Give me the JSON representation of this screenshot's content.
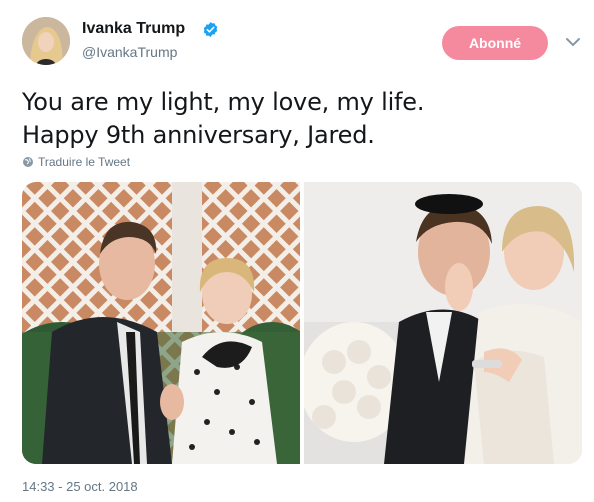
{
  "tweet": {
    "author_name": "Ivanka Trump",
    "author_handle": "@IvankaTrump",
    "follow_label": "Abonné",
    "text_line1": "You are my light, my love, my life.",
    "text_line2": "Happy 9th anniversary, Jared.",
    "translate_label": "Traduire le Tweet",
    "timestamp": "14:33 - 25 oct. 2018"
  },
  "icons": {
    "verified": "verified-badge-icon",
    "more": "chevron-down-icon",
    "globe": "globe-icon"
  },
  "colors": {
    "follow_button": "#f58a9f",
    "verified": "#1da1f2",
    "secondary_text": "#657786"
  }
}
